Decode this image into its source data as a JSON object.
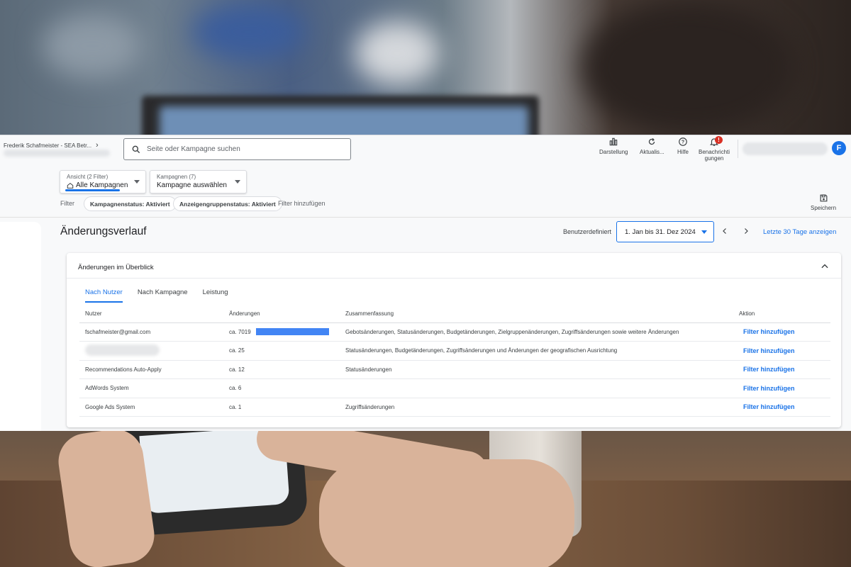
{
  "topbar": {
    "account": "Frederik Schafmeister - SEA Betr...",
    "search_placeholder": "Seite oder Kampagne suchen",
    "tools": [
      {
        "label": "Darstellung",
        "icon": "chart-icon"
      },
      {
        "label": "Aktualis...",
        "icon": "refresh-icon"
      },
      {
        "label": "Hilfe",
        "icon": "help-icon"
      },
      {
        "label": "Benachrichti\ngungen",
        "icon": "bell-icon",
        "badge": "!"
      }
    ],
    "avatar_initial": "F"
  },
  "view_dropdown": {
    "small": "Ansicht (2 Filter)",
    "value": "Alle Kampagnen"
  },
  "campaign_dropdown": {
    "small": "Kampagnen (7)",
    "value": "Kampagne auswählen"
  },
  "filters": {
    "label": "Filter",
    "chips": [
      "Kampagnenstatus: Aktiviert",
      "Anzeigengruppenstatus: Aktiviert"
    ],
    "add": "Filter hinzufügen"
  },
  "save_label": "Speichern",
  "page": {
    "title": "Änderungsverlauf",
    "range_label": "Benutzerdefiniert",
    "range_value": "1. Jan bis 31. Dez 2024",
    "last30": "Letzte 30 Tage anzeigen"
  },
  "card": {
    "title": "Änderungen im Überblick",
    "tabs": [
      "Nach Nutzer",
      "Nach Kampagne",
      "Leistung"
    ],
    "active_tab": 0,
    "columns": [
      "Nutzer",
      "Änderungen",
      "Zusammenfassung",
      "Aktion"
    ],
    "rows": [
      {
        "user": "fschafmeister@gmail.com",
        "changes": "ca. 7019",
        "share": 1.0,
        "summary": "Gebotsänderungen, Statusänderungen, Budgetänderungen, Zielgruppenänderungen, Zugriffsänderungen sowie weitere Änderungen",
        "action": "Filter hinzufügen"
      },
      {
        "user": "",
        "changes": "ca. 25",
        "share": 0,
        "summary": "Statusänderungen, Budgetänderungen, Zugriffsänderungen und Änderungen der geografischen Ausrichtung",
        "action": "Filter hinzufügen"
      },
      {
        "user": "Recommendations Auto-Apply",
        "changes": "ca. 12",
        "share": 0,
        "summary": "Statusänderungen",
        "action": "Filter hinzufügen"
      },
      {
        "user": "AdWords System",
        "changes": "ca. 6",
        "share": 0,
        "summary": "",
        "action": "Filter hinzufügen"
      },
      {
        "user": "Google Ads System",
        "changes": "ca. 1",
        "share": 0,
        "summary": "Zugriffsänderungen",
        "action": "Filter hinzufügen"
      }
    ]
  },
  "colors": {
    "accent": "#1a73e8",
    "bar": "#4285f4",
    "badge": "#d93025"
  }
}
